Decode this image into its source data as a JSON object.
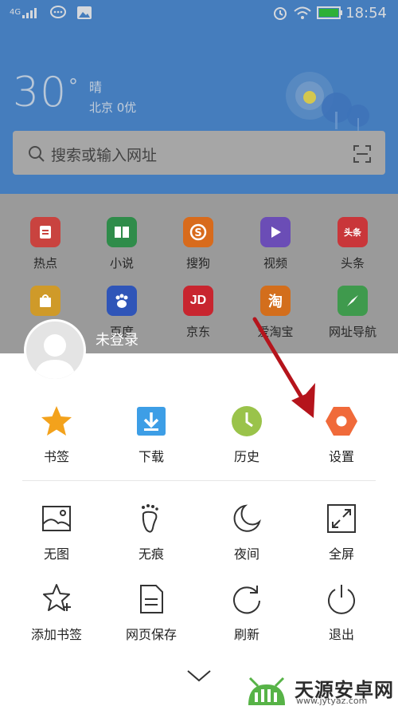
{
  "status_bar": {
    "network": "4G",
    "time": "18:54"
  },
  "weather": {
    "temperature": "30",
    "degree": "°",
    "condition": "晴",
    "city_aqi": "北京 0优"
  },
  "search": {
    "placeholder": "搜索或输入网址"
  },
  "quick_apps": [
    {
      "label": "热点",
      "color": "#c9433f"
    },
    {
      "label": "小说",
      "color": "#2f8c4a"
    },
    {
      "label": "搜狗",
      "color": "#d86b1c"
    },
    {
      "label": "视频",
      "color": "#6b4db6"
    },
    {
      "label": "头条",
      "color": "#c9363a",
      "tile_text": "头条"
    },
    {
      "label": "",
      "color": "#cf9a29"
    },
    {
      "label": "百度",
      "color": "#2f55b8"
    },
    {
      "label": "京东",
      "color": "#c8252f",
      "tile_text": "JD"
    },
    {
      "label": "爱淘宝",
      "color": "#d36e1c",
      "tile_text": "淘"
    },
    {
      "label": "网址导航",
      "color": "#3f9a4d"
    }
  ],
  "menu": {
    "user": {
      "label": "未登录"
    },
    "primary": [
      {
        "label": "书签",
        "icon": "star-icon",
        "color": "#f3a21c"
      },
      {
        "label": "下载",
        "icon": "download-icon",
        "color": "#3d9ee6"
      },
      {
        "label": "历史",
        "icon": "clock-icon",
        "color": "#9ac34a"
      },
      {
        "label": "设置",
        "icon": "gear-icon",
        "color": "#f06a3a"
      }
    ],
    "secondary": [
      {
        "label": "无图",
        "icon": "image-icon"
      },
      {
        "label": "无痕",
        "icon": "footprint-icon"
      },
      {
        "label": "夜间",
        "icon": "moon-icon"
      },
      {
        "label": "全屏",
        "icon": "fullscreen-icon"
      },
      {
        "label": "添加书签",
        "icon": "add-bookmark-icon"
      },
      {
        "label": "网页保存",
        "icon": "save-page-icon"
      },
      {
        "label": "刷新",
        "icon": "refresh-icon"
      },
      {
        "label": "退出",
        "icon": "power-icon"
      }
    ],
    "collapse_icon": "chevron-down-icon"
  },
  "annotation": {
    "arrow_color": "#b5141c"
  },
  "watermark": {
    "title": "天源安卓网",
    "url": "www.jytyaz.com"
  }
}
